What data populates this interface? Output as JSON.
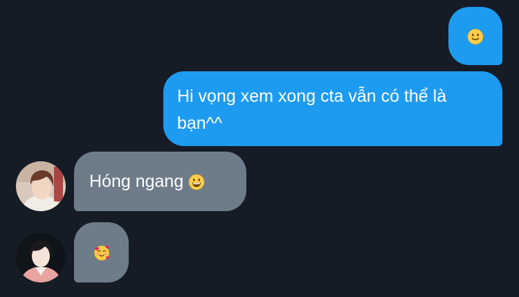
{
  "messages": [
    {
      "direction": "outgoing",
      "text": "",
      "emoji": "slightly-smiling-face-icon"
    },
    {
      "direction": "outgoing",
      "text": "Hi vọng xem xong cta vẫn có thể là bạn^^"
    },
    {
      "direction": "incoming",
      "text": "Hóng ngang ",
      "emoji": "grinning-face-icon"
    },
    {
      "direction": "incoming",
      "text": "",
      "emoji": "smiling-face-with-hearts-icon"
    }
  ],
  "colors": {
    "background": "#151c26",
    "outgoing_bubble": "#1d9bf0",
    "incoming_bubble": "#6e7c89",
    "text": "#ffffff"
  }
}
